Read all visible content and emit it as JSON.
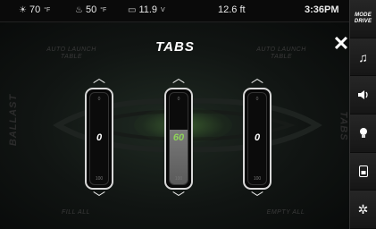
{
  "status": {
    "temp1_value": "70",
    "temp1_unit": "°F",
    "temp2_value": "50",
    "temp2_unit": "°F",
    "battery_value": "11.9",
    "battery_unit": "V",
    "depth": "12.6 ft",
    "time": "3:36PM"
  },
  "title": "TABS",
  "close_label": "✕",
  "ghost_labels": {
    "left_top": "AUTO LAUNCH\nTABLE",
    "right_top": "AUTO LAUNCH\nTABLE",
    "left_bottom": "FILL ALL",
    "right_bottom": "EMPTY ALL",
    "left_side": "BALLAST",
    "right_side": "TABS"
  },
  "tabs": [
    {
      "value": "0",
      "level": 0,
      "top_tick": "0",
      "bottom_tick": "100",
      "active": false
    },
    {
      "value": "60",
      "level": 0.6,
      "top_tick": "0",
      "bottom_tick": "100",
      "active": true
    },
    {
      "value": "0",
      "level": 0,
      "top_tick": "0",
      "bottom_tick": "100",
      "active": false
    }
  ],
  "sidebar": {
    "mode_label": "MODE\nDRIVE",
    "items": [
      "mode",
      "music-icon",
      "volume-icon",
      "light-icon",
      "storage-icon",
      "settings-icon"
    ]
  }
}
